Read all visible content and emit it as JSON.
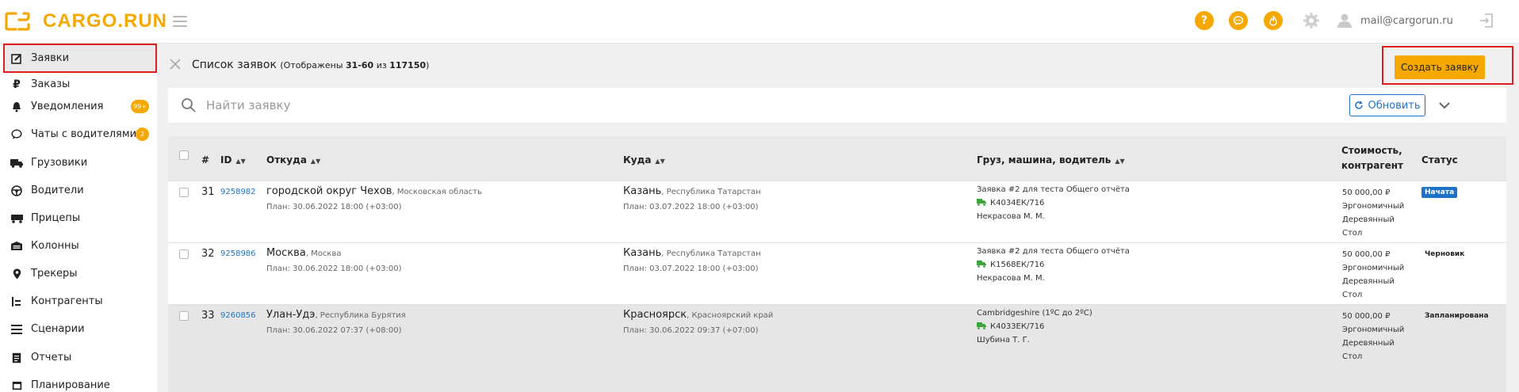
{
  "header": {
    "logo_text": "CARGO.RUN",
    "help_label": "?",
    "user_email": "mail@cargorun.ru",
    "accent_color": "#f5a800"
  },
  "sidebar": {
    "items": [
      {
        "label": "Заявки",
        "icon": "edit-icon",
        "active": true
      },
      {
        "label": "Заказы",
        "icon": "ruble-icon"
      },
      {
        "label": "Уведомления",
        "icon": "bell-icon",
        "badge": "99+"
      },
      {
        "label": "Чаты с водителями",
        "icon": "chat-icon",
        "badge": "2"
      },
      {
        "label": "Грузовики",
        "icon": "truck-icon"
      },
      {
        "label": "Водители",
        "icon": "steering-wheel-icon"
      },
      {
        "label": "Прицепы",
        "icon": "trailer-icon"
      },
      {
        "label": "Колонны",
        "icon": "garage-icon"
      },
      {
        "label": "Трекеры",
        "icon": "map-pin-icon"
      },
      {
        "label": "Контрагенты",
        "icon": "contractors-icon"
      },
      {
        "label": "Сценарии",
        "icon": "list-icon"
      },
      {
        "label": "Отчеты",
        "icon": "report-icon"
      },
      {
        "label": "Планирование",
        "icon": "calendar-icon"
      }
    ]
  },
  "toolbar": {
    "title": "Список заявок",
    "shown_prefix": "(Отображены ",
    "shown_range": "31-60",
    "shown_of": " из ",
    "shown_total": "117150",
    "shown_suffix": ")",
    "create_label": "Создать заявку"
  },
  "search": {
    "placeholder": "Найти заявку",
    "refresh_label": "Обновить"
  },
  "table": {
    "headers": {
      "num": "#",
      "id": "ID",
      "from": "Откуда",
      "to": "Куда",
      "cargo": "Груз, машина, водитель",
      "cost_line1": "Стоимость,",
      "cost_line2": "контрагент",
      "status": "Статус"
    },
    "rows": [
      {
        "num": "31",
        "id": "9258982",
        "from_city": "городской округ Чехов",
        "from_region": "Московская область",
        "from_plan": "План: 30.06.2022 18:00 (+03:00)",
        "to_city": "Казань",
        "to_region": "Республика Татарстан",
        "to_plan": "План: 03.07.2022 18:00 (+03:00)",
        "cargo": "Заявка #2 для теста Общего отчёта",
        "truck": "К4034ЕК/716",
        "driver": "Некрасова М. М.",
        "cost": "50 000,00 ₽",
        "contractor_1": "Эргономичный",
        "contractor_2": "Деревянный",
        "contractor_3": "Стол",
        "status": "Начата"
      },
      {
        "num": "32",
        "id": "9258986",
        "from_city": "Москва",
        "from_region": "Москва",
        "from_plan": "План: 30.06.2022 18:00 (+03:00)",
        "to_city": "Казань",
        "to_region": "Республика Татарстан",
        "to_plan": "План: 03.07.2022 18:00 (+03:00)",
        "cargo": "Заявка #2 для теста Общего отчёта",
        "truck": "К1568ЕК/716",
        "driver": "Некрасова М. М.",
        "cost": "50 000,00 ₽",
        "contractor_1": "Эргономичный",
        "contractor_2": "Деревянный",
        "contractor_3": "Стол",
        "status": "Черновик"
      },
      {
        "num": "33",
        "id": "9260856",
        "from_city": "Улан-Удэ",
        "from_region": "Республика Бурятия",
        "from_plan": "План: 30.06.2022 07:37 (+08:00)",
        "to_city": "Красноярск",
        "to_region": "Красноярский край",
        "to_plan": "План: 30.06.2022 09:37 (+07:00)",
        "cargo": "Cambridgeshire (1ºC до 2ºC)",
        "truck": "К4033ЕК/716",
        "driver": "Шубина Т. Г.",
        "cost": "50 000,00 ₽",
        "contractor_1": "Эргономичный",
        "contractor_2": "Деревянный",
        "contractor_3": "Стол",
        "status": "Запланирована"
      }
    ]
  }
}
